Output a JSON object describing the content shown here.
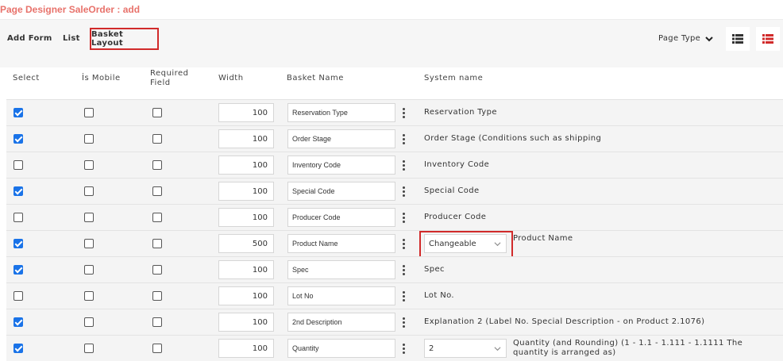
{
  "page_title": "Page Designer SaleOrder : add",
  "toolbar": {
    "add_form": "Add Form",
    "list": "List",
    "basket_layout": "Basket Layout",
    "page_type": "Page Type"
  },
  "columns": {
    "select": "Select",
    "is_mobile": "İs Mobile",
    "required_field_line1": "Required",
    "required_field_line2": "Field",
    "width": "Width",
    "basket_name": "Basket Name",
    "system_name": "System name"
  },
  "rows": [
    {
      "select": true,
      "mobile": false,
      "required": false,
      "width": "100",
      "basket_name": "Reservation Type",
      "system_name": "Reservation Type"
    },
    {
      "select": true,
      "mobile": false,
      "required": false,
      "width": "100",
      "basket_name": "Order Stage",
      "system_name": "Order Stage (Conditions such as shipping"
    },
    {
      "select": false,
      "mobile": false,
      "required": false,
      "width": "100",
      "basket_name": "Inventory Code",
      "system_name": "Inventory Code"
    },
    {
      "select": true,
      "mobile": false,
      "required": false,
      "width": "100",
      "basket_name": "Special Code",
      "system_name": "Special Code"
    },
    {
      "select": false,
      "mobile": false,
      "required": false,
      "width": "100",
      "basket_name": "Producer Code",
      "system_name": "Producer Code"
    },
    {
      "select": true,
      "mobile": false,
      "required": false,
      "width": "500",
      "basket_name": "Product Name",
      "system_name": "Product Name",
      "dropdown": "Changeable"
    },
    {
      "select": true,
      "mobile": false,
      "required": false,
      "width": "100",
      "basket_name": "Spec",
      "system_name": "Spec"
    },
    {
      "select": false,
      "mobile": false,
      "required": false,
      "width": "100",
      "basket_name": "Lot No",
      "system_name": "Lot No."
    },
    {
      "select": true,
      "mobile": false,
      "required": false,
      "width": "100",
      "basket_name": "2nd Description",
      "system_name": "Explanation 2 (Label No. Special Description - on Product 2.1076)"
    },
    {
      "select": true,
      "mobile": false,
      "required": false,
      "width": "100",
      "basket_name": "Quantity",
      "system_name": "Quantity (and Rounding) (1 - 1.1 - 1.111 - 1.1111 The quantity is arranged as)",
      "dropdown": "2"
    }
  ],
  "colors": {
    "title": "#e8726b",
    "checkbox_checked": "#1a73e8",
    "highlight": "#d12a2a",
    "list_icon_active": "#d12a2a"
  },
  "icons": [
    "chevron-down-icon",
    "list-view-icon",
    "list-view-active-icon",
    "kebab-menu-icon"
  ]
}
